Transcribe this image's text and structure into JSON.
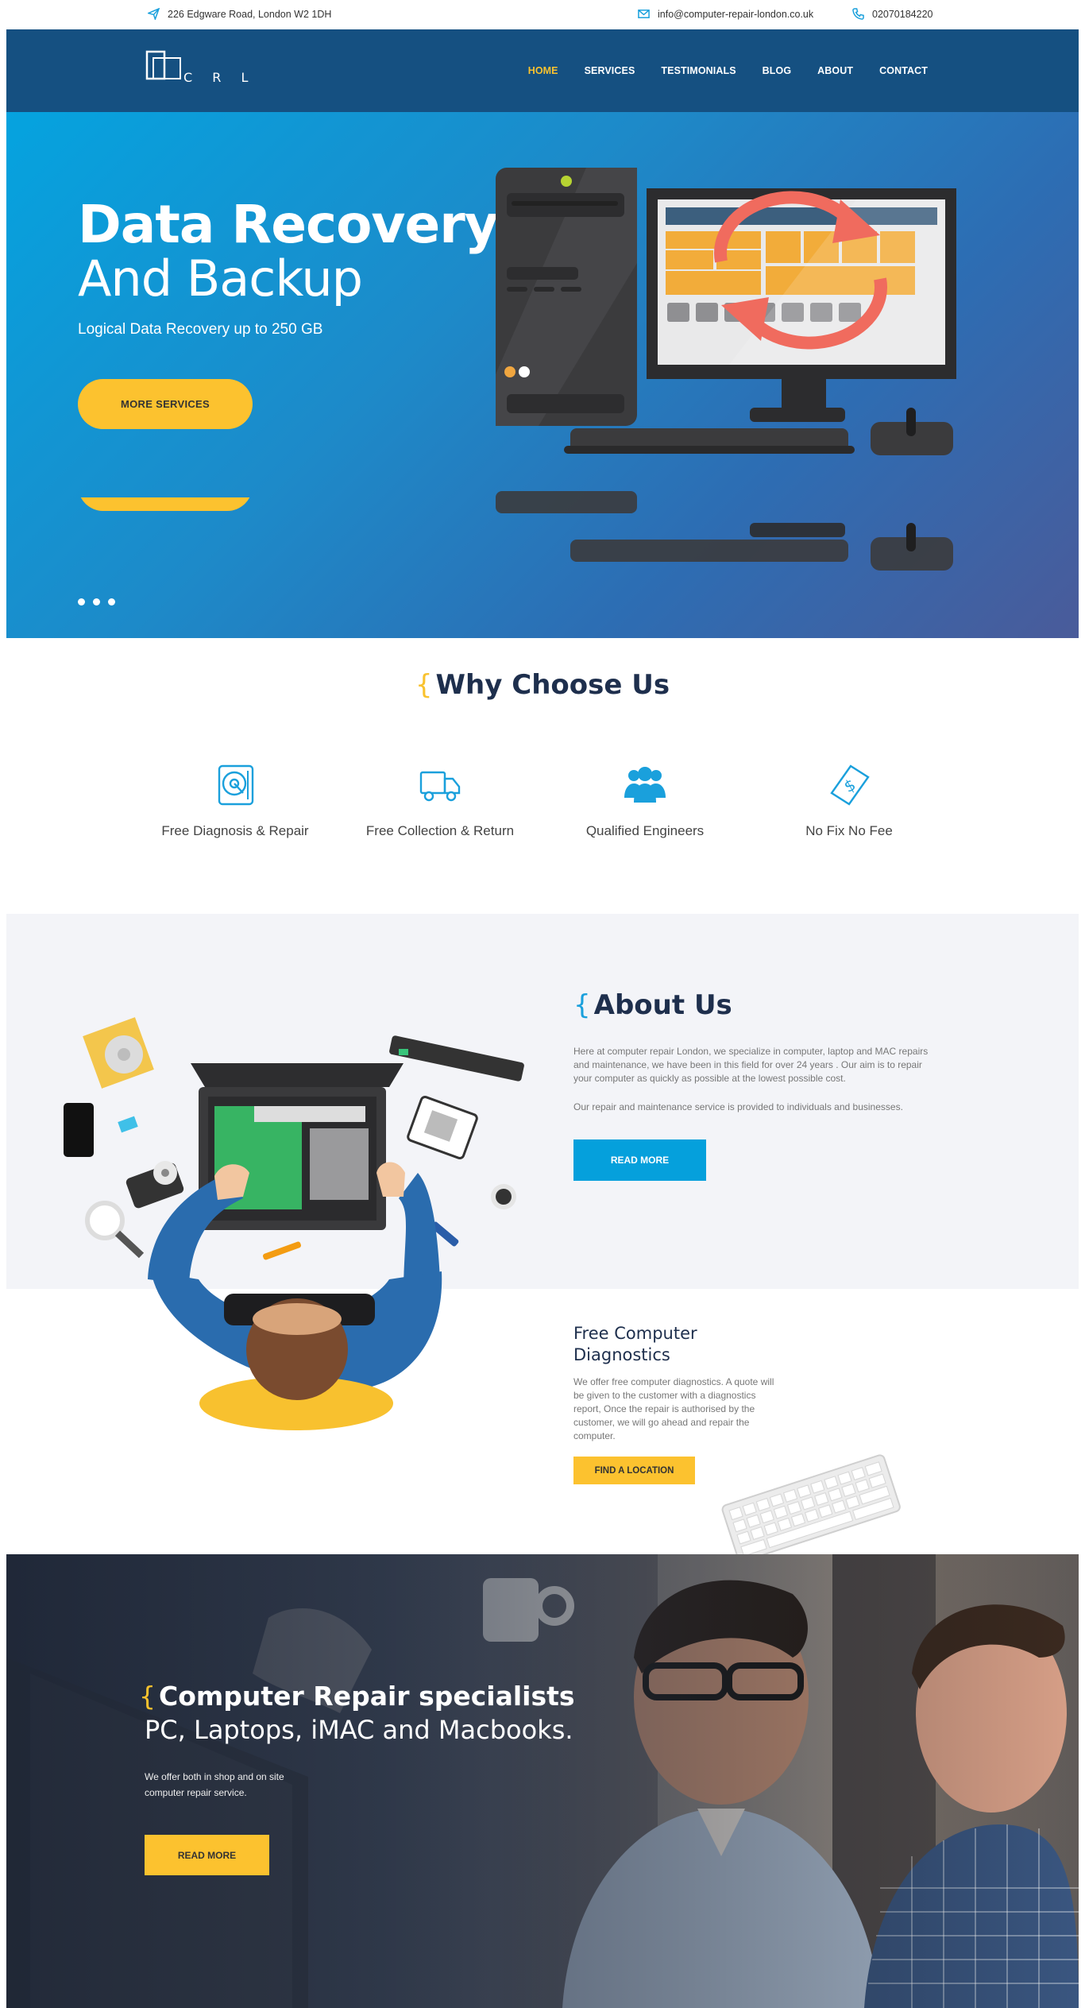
{
  "topbar": {
    "address": "226 Edgware Road, London W2 1DH",
    "email": "info@computer-repair-london.co.uk",
    "phone": "02070184220"
  },
  "header": {
    "logo_text": "C R L",
    "nav": [
      {
        "label": "HOME",
        "active": true
      },
      {
        "label": "SERVICES",
        "active": false
      },
      {
        "label": "TESTIMONIALS",
        "active": false
      },
      {
        "label": "BLOG",
        "active": false
      },
      {
        "label": "ABOUT",
        "active": false
      },
      {
        "label": "CONTACT",
        "active": false
      }
    ]
  },
  "hero": {
    "title_line1": "Data Recovery",
    "title_line2": "And Backup",
    "subtitle": "Logical Data Recovery up to 250 GB",
    "button": "MORE SERVICES",
    "slides": 3
  },
  "why": {
    "title": "Why Choose Us",
    "features": [
      {
        "label": "Free Diagnosis & Repair",
        "icon": "diagnosis-icon"
      },
      {
        "label": "Free Collection & Return",
        "icon": "delivery-truck-icon"
      },
      {
        "label": "Qualified Engineers",
        "icon": "engineers-group-icon"
      },
      {
        "label": "No Fix No Fee",
        "icon": "money-tag-icon"
      }
    ]
  },
  "about": {
    "title": "About Us",
    "paragraph1": "Here at computer repair London, we specialize in computer, laptop and MAC repairs and maintenance, we have been in this field for over 24 years . Our aim is to repair your computer as quickly as possible at the lowest possible cost.",
    "paragraph2": "Our repair and maintenance service is provided to individuals and businesses.",
    "button": "READ MORE"
  },
  "diagnostics": {
    "title": "Free Computer Diagnostics",
    "paragraph": "We offer free computer diagnostics. A quote will be given to the customer with a diagnostics report, Once the repair is authorised by the customer, we will go ahead and repair the computer.",
    "button": "FIND A LOCATION"
  },
  "specialists": {
    "title_line1": "Computer Repair specialists",
    "title_line2": "PC, Laptops, iMAC and Macbooks.",
    "paragraph": "We offer both in shop and on site computer repair service.",
    "button": "READ MORE"
  },
  "colors": {
    "navy": "#155081",
    "accent_yellow": "#fcc22f",
    "accent_blue": "#05a0dc",
    "heading": "#1e2f4d"
  }
}
